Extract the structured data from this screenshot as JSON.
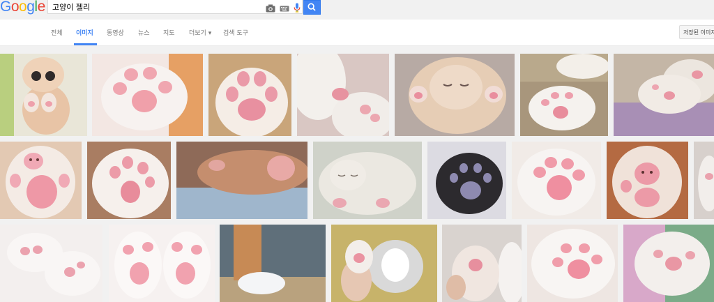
{
  "header": {
    "logo": {
      "text": "Google",
      "colors": [
        "#4285f4",
        "#ea4335",
        "#fbbc05",
        "#4285f4",
        "#34a853",
        "#ea4335"
      ]
    },
    "search": {
      "value": "고양이 젤리"
    },
    "icons": [
      "camera-icon",
      "keyboard-icon",
      "microphone-icon",
      "search-icon"
    ]
  },
  "tabs": [
    {
      "label": "전체",
      "active": false
    },
    {
      "label": "이미지",
      "active": true
    },
    {
      "label": "동영상",
      "active": false
    },
    {
      "label": "뉴스",
      "active": false
    },
    {
      "label": "지도",
      "active": false
    },
    {
      "label": "더보기 ▾",
      "active": false
    },
    {
      "label": "검색 도구",
      "active": false
    }
  ],
  "saved_images_button": "저장된 이미지",
  "colors": {
    "accent": "#4285f4",
    "grid_bg": "#f1f1f1"
  },
  "results": {
    "row1": [
      "kitten-standing",
      "paw-pink-pads",
      "paw-closeup",
      "white-paw-nose",
      "kitten-sleeping-paws",
      "white-paw-on-rug",
      "paws-on-purple-blanket"
    ],
    "row2": [
      "paw-bear-pattern",
      "paw-held-hand",
      "paw-on-blanket",
      "kitten-sleeping",
      "dark-paw",
      "pink-pads-closeup",
      "paw-teddy-bear",
      "partial"
    ],
    "row3": [
      "white-paws-pair",
      "pink-paws-pair",
      "cat-leg-white-sock",
      "husky-puppy-paw",
      "paw-held-fingers",
      "paw-toe-beans",
      "paw-pink-pads-partial"
    ]
  }
}
